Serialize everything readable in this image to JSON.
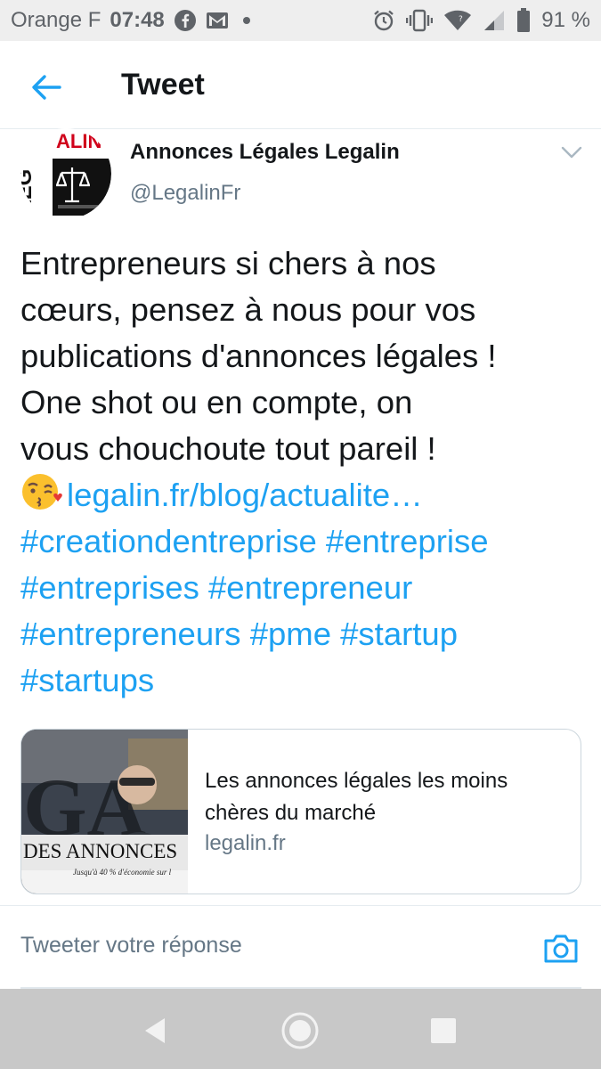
{
  "status_bar": {
    "carrier": "Orange F",
    "time": "07:48",
    "battery": "91 %",
    "icons": [
      "facebook-icon",
      "gmail-icon",
      "dot-icon",
      "alarm-icon",
      "vibrate-icon",
      "wifi-icon",
      "signal-icon",
      "battery-icon"
    ]
  },
  "header": {
    "back_icon": "arrow-left-icon",
    "title": "Tweet"
  },
  "author": {
    "name": "Annonces Légales Legalin",
    "handle": "@LegalinFr",
    "avatar_logo_text": "LEGALIN"
  },
  "tweet": {
    "lines": [
      "Entrepreneurs si chers à nos",
      "cœurs, pensez à nous pour vos",
      "publications d'annonces légales !",
      "One shot ou en compte, on",
      "vous chouchoute tout pareil !"
    ],
    "link": "legalin.fr/blog/actualite…",
    "hashtag_lines": [
      "#creationdentreprise #entreprise",
      "#entreprises #entrepreneur",
      "#entrepreneurs #pme #startup",
      "#startups"
    ]
  },
  "card": {
    "image_text_main": "DES ANNONCES",
    "image_text_sub": "Jusqu'à 40 % d'économie sur l",
    "title": "Les annonces légales les moins chères du marché",
    "domain": "legalin.fr"
  },
  "reply": {
    "placeholder": "Tweeter votre réponse"
  },
  "colors": {
    "accent": "#1da1f2",
    "text": "#14171a",
    "secondary": "#657786"
  }
}
